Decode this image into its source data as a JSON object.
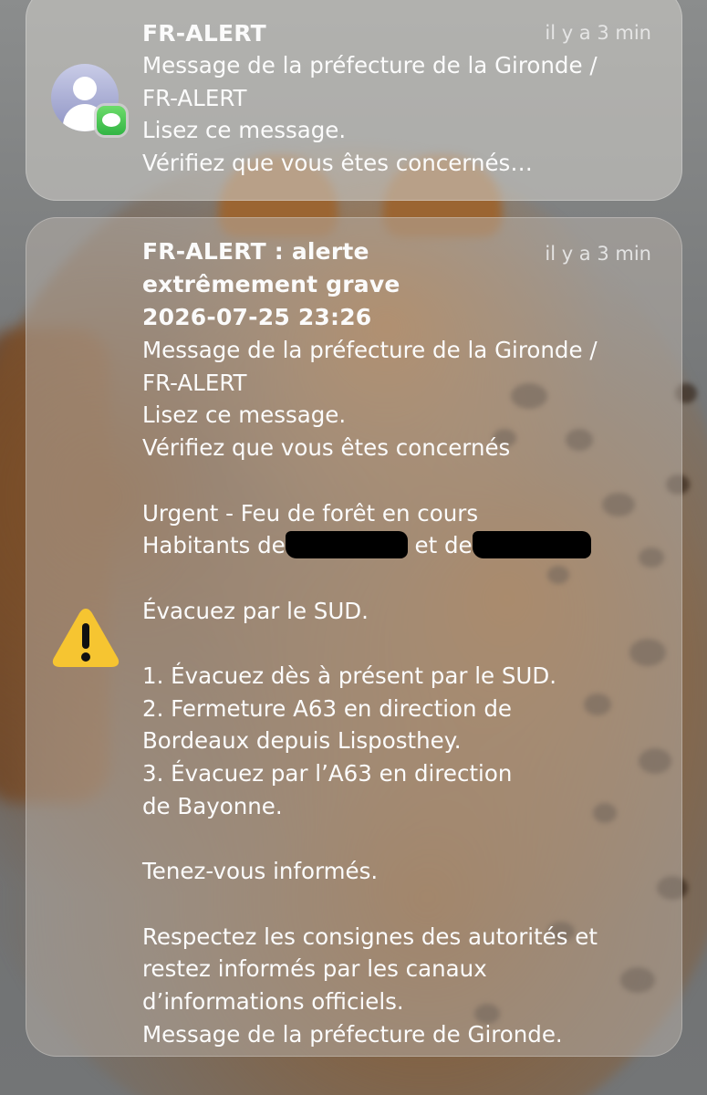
{
  "notifications": [
    {
      "title": "FR-ALERT",
      "time": "il y a 3 min",
      "lines": [
        "Message de la préfecture de la Gironde /",
        "FR-ALERT",
        "Lisez ce message.",
        "Vérifiez que vous êtes concernés…"
      ],
      "icon": "person-avatar-icon",
      "badge_icon": "messages-app-icon"
    },
    {
      "title_lines": [
        "FR-ALERT : alerte",
        "extrêmement grave",
        "2026-07-25 23:26"
      ],
      "time": "il y a 3 min",
      "icon": "warning-triangle-icon",
      "lines": [
        "Message de la préfecture de la Gironde /",
        "FR-ALERT",
        "Lisez ce message.",
        "Vérifiez que vous êtes concernés",
        "",
        "Urgent - Feu de forêt en cours"
      ],
      "habitants_prefix": "Habitants de",
      "habitants_middle": "et de",
      "lines_after": [
        "",
        "Évacuez par le SUD.",
        "",
        "1. Évacuez dès à présent par le SUD.",
        "2. Fermeture A63 en direction de",
        "Bordeaux depuis Lisposthey.",
        "3. Évacuez par l’A63 en direction",
        "de Bayonne.",
        "",
        "Tenez-vous informés.",
        "",
        "Respectez les consignes des autorités et",
        "restez informés par les canaux",
        "d’informations officiels.",
        "Message de la préfecture de Gironde."
      ]
    }
  ],
  "colors": {
    "warning_yellow": "#f6c531",
    "messages_green": "#34c759"
  }
}
